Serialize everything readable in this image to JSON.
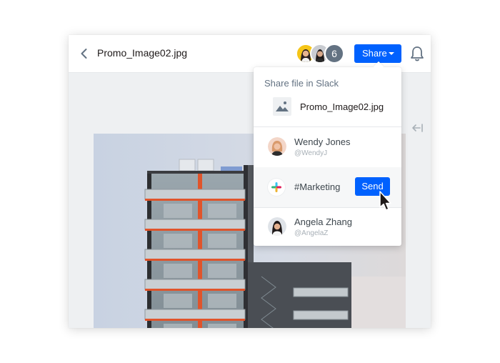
{
  "header": {
    "file_name": "Promo_Image02.jpg",
    "collaborator_count": "6",
    "share_label": "Share"
  },
  "share_popover": {
    "title": "Share file in Slack",
    "file_name": "Promo_Image02.jpg",
    "recipients": [
      {
        "name": "Wendy Jones",
        "handle": "@WendyJ"
      },
      {
        "name": "Angela Zhang",
        "handle": "@AngelaZ"
      }
    ],
    "channel": {
      "name": "#Marketing",
      "send_label": "Send"
    }
  },
  "colors": {
    "accent": "#0061fe",
    "building_accent": "#e0542b",
    "sky": "#cfd6e3"
  },
  "icons": [
    "back-chevron-icon",
    "bell-icon",
    "collapse-panel-icon",
    "image-file-icon",
    "slack-icon",
    "mouse-cursor-icon"
  ]
}
